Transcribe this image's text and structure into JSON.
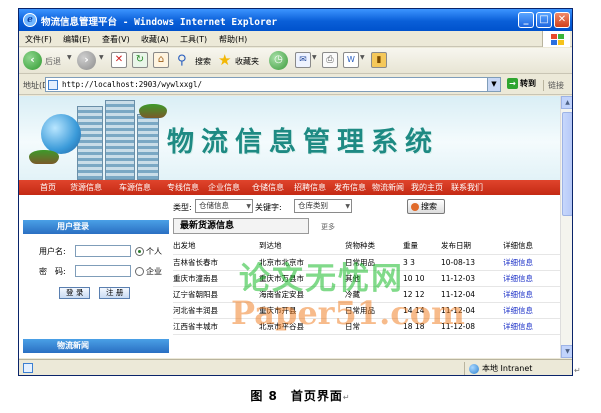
{
  "window": {
    "title": "物流信息管理平台 - Windows Internet Explorer",
    "minimize": "_",
    "maximize": "□",
    "close": "✕"
  },
  "menubar": [
    "文件(F)",
    "编辑(E)",
    "查看(V)",
    "收藏(A)",
    "工具(T)",
    "帮助(H)"
  ],
  "toolbar": {
    "back": "后退",
    "search": "搜索",
    "favorites": "收藏夹"
  },
  "address": {
    "label": "地址(D)",
    "url": "http://localhost:2903/wywlxxgl/",
    "go": "转到",
    "links": "链接"
  },
  "site": {
    "title": "物流信息管理系统",
    "nav": [
      "首页",
      "货源信息",
      "车源信息",
      "专线信息",
      "企业信息",
      "仓储信息",
      "招聘信息",
      "发布信息",
      "物流新闻",
      "我的主页",
      "联系我们"
    ]
  },
  "search": {
    "type_label": "类型:",
    "type_value": "仓储信息",
    "keyword_label": "关键字:",
    "keyword_value": "仓库类别",
    "button": "搜索"
  },
  "login": {
    "header": "用户登录",
    "username_label": "用户名:",
    "password_label": "密　码:",
    "role_personal": "个人",
    "role_company": "企业",
    "login_button": "登 录",
    "register_button": "注 册"
  },
  "news": {
    "header": "物流新闻"
  },
  "latest": {
    "title": "最新货源信息",
    "more": "更多"
  },
  "goods_table": {
    "columns": [
      "出发地",
      "到达地",
      "货物种类",
      "重量",
      "发布日期",
      "详细信息"
    ],
    "rows": [
      [
        "吉林省长春市",
        "北京市北京市",
        "日常用品",
        "3 3",
        "10-08-13",
        "详细信息"
      ],
      [
        "重庆市潼南县",
        "重庆市万县市",
        "其他",
        "10 10",
        "11-12-03",
        "详细信息"
      ],
      [
        "辽宁省朝阳县",
        "海南省定安县",
        "冷藏",
        "12 12",
        "11-12-04",
        "详细信息"
      ],
      [
        "河北省丰润县",
        "重庆市开县",
        "日常用品",
        "14 14",
        "11-12-04",
        "详细信息"
      ],
      [
        "江西省丰城市",
        "北京市平谷县",
        "日常",
        "18 18",
        "11-12-08",
        "详细信息"
      ]
    ]
  },
  "watermark": {
    "line1": "论文无忧网",
    "line2": "Paper51.com"
  },
  "status": {
    "zone": "本地 Intranet"
  },
  "caption": "图 8　首页界面",
  "caption_mark": "↵"
}
